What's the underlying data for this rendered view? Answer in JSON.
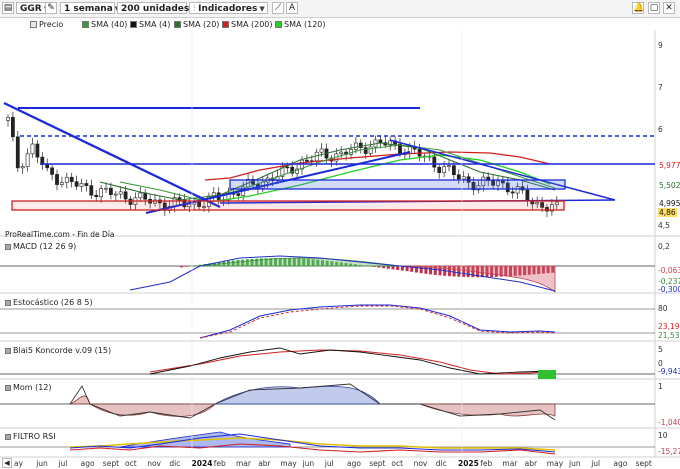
{
  "toolbar": {
    "symbol": "GGR",
    "period": "1 semana",
    "units": "200 unidades",
    "indicators": "Indicadores"
  },
  "legend": [
    {
      "label": "Precio",
      "color": "#e8e8e8"
    },
    {
      "label": "SMA (40)",
      "color": "#3a9a3a"
    },
    {
      "label": "SMA (4)",
      "color": "#111111"
    },
    {
      "label": "SMA (20)",
      "color": "#2f6f2f"
    },
    {
      "label": "SMA (200)",
      "color": "#d02020"
    },
    {
      "label": "SMA (120)",
      "color": "#22d022"
    }
  ],
  "price_axis": {
    "ticks": [
      "9",
      "7",
      "6",
      "4,5"
    ],
    "badges": [
      {
        "text": "5,977",
        "color": "#d02020",
        "bg": "#ffffff"
      },
      {
        "text": "5,502",
        "color": "#2f6f2f",
        "bg": "#ffffff"
      },
      {
        "text": "4,995",
        "color": "#111111",
        "bg": "#ffffff"
      },
      {
        "text": "4,86",
        "color": "#111111",
        "bg": "#ffe066"
      }
    ]
  },
  "source_label": "ProRealTime.com - Fin de Día",
  "panels": {
    "macd": {
      "label": "MACD (12 26 9)",
      "ticks": [
        "0,2",
        "-0,063",
        "-0,237",
        "-0,300"
      ]
    },
    "stoch": {
      "label": "Estocástico (26 8 5)",
      "ticks": [
        "80",
        "23,19",
        "21,53"
      ]
    },
    "koncorde": {
      "label": "Blai5 Koncorde v.09 (15)",
      "ticks": [
        "5",
        "0",
        "-9,943"
      ]
    },
    "mom": {
      "label": "Mom (12)",
      "ticks": [
        "1",
        "-1,040"
      ]
    },
    "rsi": {
      "label": "FILTRO RSI",
      "ticks": [
        "10",
        "-15,27"
      ]
    }
  },
  "xaxis": {
    "labels": [
      "ay",
      "jun",
      "jul",
      "ago",
      "sept",
      "oct",
      "nov",
      "dic",
      "2024",
      "feb",
      "mar",
      "abr",
      "may",
      "jun",
      "jul",
      "ago",
      "sept",
      "oct",
      "nov",
      "dic",
      "2025",
      "feb",
      "mar",
      "abr",
      "may",
      "jun",
      "jul",
      "ago",
      "sept"
    ],
    "bold": [
      "2024",
      "2025"
    ]
  },
  "chart_data": {
    "type": "candlestick",
    "title": "GGR",
    "period": "1 semana",
    "y_ticks": [
      9,
      7,
      6,
      4.5
    ],
    "last_values": {
      "SMA (200)": 5.977,
      "SMA (20)": 5.502,
      "SMA (4)": 4.995,
      "Precio": 4.86
    },
    "price_path": [
      [
        0,
        7.2
      ],
      [
        2,
        6.0
      ],
      [
        5,
        6.5
      ],
      [
        8,
        5.8
      ],
      [
        12,
        5.6
      ],
      [
        16,
        5.4
      ],
      [
        20,
        5.3
      ],
      [
        24,
        5.2
      ],
      [
        28,
        5.1
      ],
      [
        32,
        5.0
      ],
      [
        36,
        5.0
      ],
      [
        40,
        5.05
      ],
      [
        44,
        5.2
      ],
      [
        48,
        5.4
      ],
      [
        52,
        5.6
      ],
      [
        56,
        5.8
      ],
      [
        60,
        6.1
      ],
      [
        64,
        6.3
      ],
      [
        68,
        6.3
      ],
      [
        72,
        6.5
      ],
      [
        76,
        6.6
      ],
      [
        80,
        6.5
      ],
      [
        84,
        6.3
      ],
      [
        88,
        6.0
      ],
      [
        92,
        5.7
      ],
      [
        96,
        5.5
      ],
      [
        100,
        5.6
      ],
      [
        104,
        5.3
      ],
      [
        108,
        5.0
      ],
      [
        112,
        4.86
      ]
    ],
    "sma_200_last": 5.977,
    "sma_20_last": 5.502,
    "sma_4_last": 4.995
  }
}
